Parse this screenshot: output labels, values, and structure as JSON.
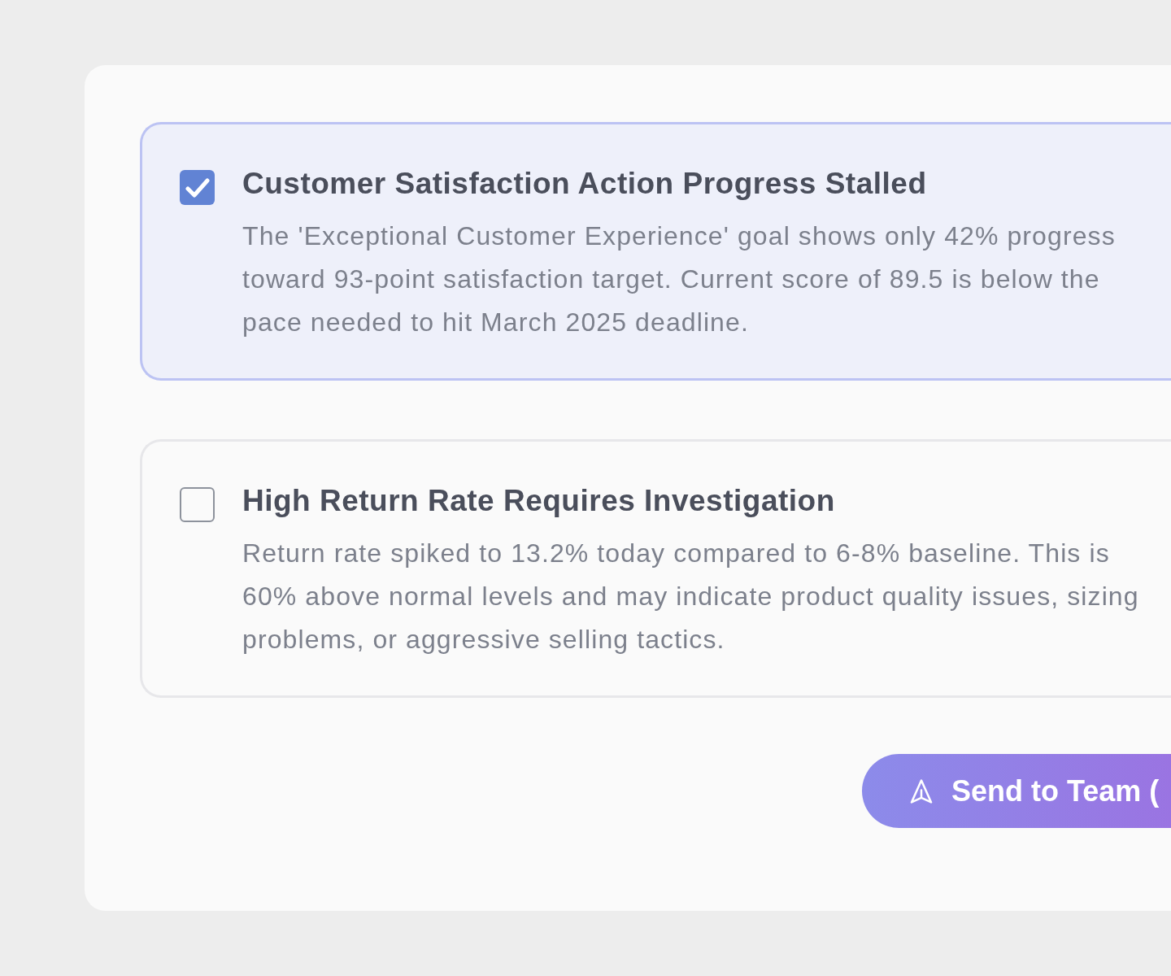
{
  "alerts": [
    {
      "title": "Customer Satisfaction Action Progress Stalled",
      "description": "The 'Exceptional Customer Experience' goal shows only 42% progress toward 93-point satisfaction target. Current score of 89.5 is below the pace needed to hit March 2025 deadline.",
      "checked": true
    },
    {
      "title": "High Return Rate Requires Investigation",
      "description": "Return rate spiked to 13.2% today compared to 6-8% baseline. This is 60% above normal levels and may indicate product quality issues, sizing problems, or aggressive selling tactics.",
      "checked": false
    }
  ],
  "send_button": {
    "label": "Send to Team ("
  }
}
